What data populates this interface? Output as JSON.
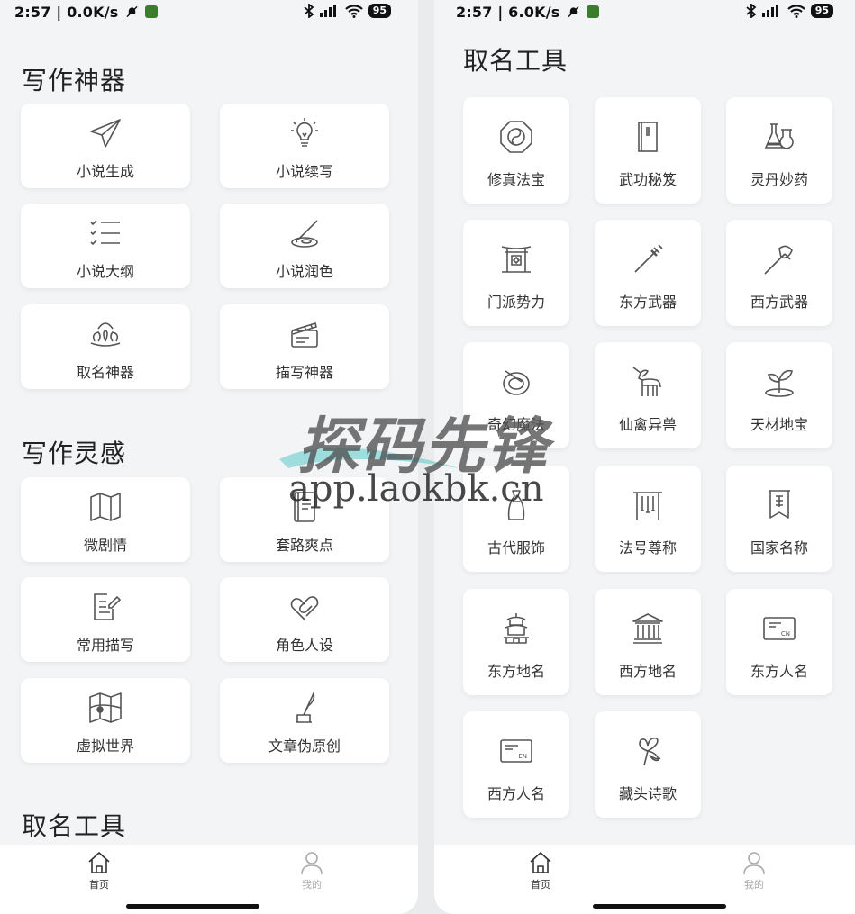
{
  "left": {
    "status": {
      "time": "2:57 | 0.0K/s",
      "battery": "95"
    },
    "sections": [
      {
        "title": "写作神器",
        "items": [
          {
            "label": "小说生成",
            "icon": "paper-plane-icon"
          },
          {
            "label": "小说续写",
            "icon": "lightbulb-icon"
          },
          {
            "label": "小说大纲",
            "icon": "checklist-icon"
          },
          {
            "label": "小说润色",
            "icon": "brush-palette-icon"
          },
          {
            "label": "取名神器",
            "icon": "crown-icon"
          },
          {
            "label": "描写神器",
            "icon": "clapperboard-icon"
          }
        ]
      },
      {
        "title": "写作灵感",
        "items": [
          {
            "label": "微剧情",
            "icon": "map-icon"
          },
          {
            "label": "套路爽点",
            "icon": "book-icon"
          },
          {
            "label": "常用描写",
            "icon": "note-edit-icon"
          },
          {
            "label": "角色人设",
            "icon": "hearts-icon"
          },
          {
            "label": "虚拟世界",
            "icon": "world-map-icon"
          },
          {
            "label": "文章伪原创",
            "icon": "quill-ink-icon"
          }
        ]
      },
      {
        "title": "取名工具"
      }
    ],
    "tabs": [
      {
        "label": "首页",
        "icon": "home-icon"
      },
      {
        "label": "我的",
        "icon": "user-icon"
      }
    ]
  },
  "right": {
    "status": {
      "time": "2:57 | 6.0K/s",
      "battery": "95"
    },
    "title": "取名工具",
    "items": [
      {
        "label": "修真法宝",
        "icon": "bagua-icon"
      },
      {
        "label": "武功秘笈",
        "icon": "scroll-book-icon"
      },
      {
        "label": "灵丹妙药",
        "icon": "flask-icon"
      },
      {
        "label": "门派势力",
        "icon": "gate-icon"
      },
      {
        "label": "东方武器",
        "icon": "sword-icon"
      },
      {
        "label": "西方武器",
        "icon": "axe-icon"
      },
      {
        "label": "奇幻魔法",
        "icon": "magic-orb-icon"
      },
      {
        "label": "仙禽异兽",
        "icon": "unicorn-icon"
      },
      {
        "label": "天材地宝",
        "icon": "sprout-icon"
      },
      {
        "label": "古代服饰",
        "icon": "dress-icon"
      },
      {
        "label": "法号尊称",
        "icon": "chime-icon"
      },
      {
        "label": "国家名称",
        "icon": "banner-icon"
      },
      {
        "label": "东方地名",
        "icon": "pagoda-icon"
      },
      {
        "label": "西方地名",
        "icon": "temple-icon"
      },
      {
        "label": "东方人名",
        "icon": "id-card-cn-icon"
      },
      {
        "label": "西方人名",
        "icon": "id-card-en-icon"
      },
      {
        "label": "藏头诗歌",
        "icon": "ribbon-poem-icon"
      }
    ],
    "tabs": [
      {
        "label": "首页",
        "icon": "home-icon"
      },
      {
        "label": "我的",
        "icon": "user-icon"
      }
    ]
  },
  "card_id_tags": {
    "cn": "CN",
    "en": "EN"
  },
  "watermark": {
    "title": "探码先锋",
    "url": "app.laokbk.cn"
  },
  "colors": {
    "background": "#f3f4f6",
    "card": "#ffffff",
    "icon": "#555555",
    "tab_active": "#333333",
    "tab_inactive": "#aaaaaa"
  }
}
